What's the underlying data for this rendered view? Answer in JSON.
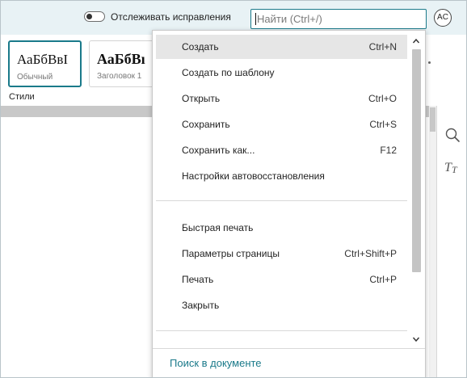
{
  "topbar": {
    "track_changes_label": "Отслеживать исправления",
    "track_changes_on": false,
    "search_placeholder": "Найти (Ctrl+/)",
    "avatar_initials": "AC"
  },
  "ribbon": {
    "styles": [
      {
        "sample": "АаБбВвІ",
        "name": "Обычный",
        "selected": true
      },
      {
        "sample": "АаБбВı",
        "name": "Заголовок 1",
        "selected": false
      }
    ],
    "styles_label": "Стили"
  },
  "sidebar": {
    "icons": [
      "search-icon",
      "text-style-icon"
    ]
  },
  "menu": {
    "group1": [
      {
        "label": "Создать",
        "shortcut": "Ctrl+N"
      },
      {
        "label": "Создать по шаблону",
        "shortcut": ""
      },
      {
        "label": "Открыть",
        "shortcut": "Ctrl+O"
      },
      {
        "label": "Сохранить",
        "shortcut": "Ctrl+S"
      },
      {
        "label": "Сохранить как...",
        "shortcut": "F12"
      },
      {
        "label": "Настройки автовосстановления",
        "shortcut": ""
      }
    ],
    "group2": [
      {
        "label": "Быстрая печать",
        "shortcut": ""
      },
      {
        "label": "Параметры страницы",
        "shortcut": "Ctrl+Shift+P"
      },
      {
        "label": "Печать",
        "shortcut": "Ctrl+P"
      },
      {
        "label": "Закрыть",
        "shortcut": ""
      }
    ],
    "hovered_item": "Создать",
    "footer_link": "Поиск в документе"
  },
  "colors": {
    "accent": "#1a7a8a",
    "topbar_bg": "#e8f2f5",
    "hover_bg": "#e6e6e6"
  }
}
